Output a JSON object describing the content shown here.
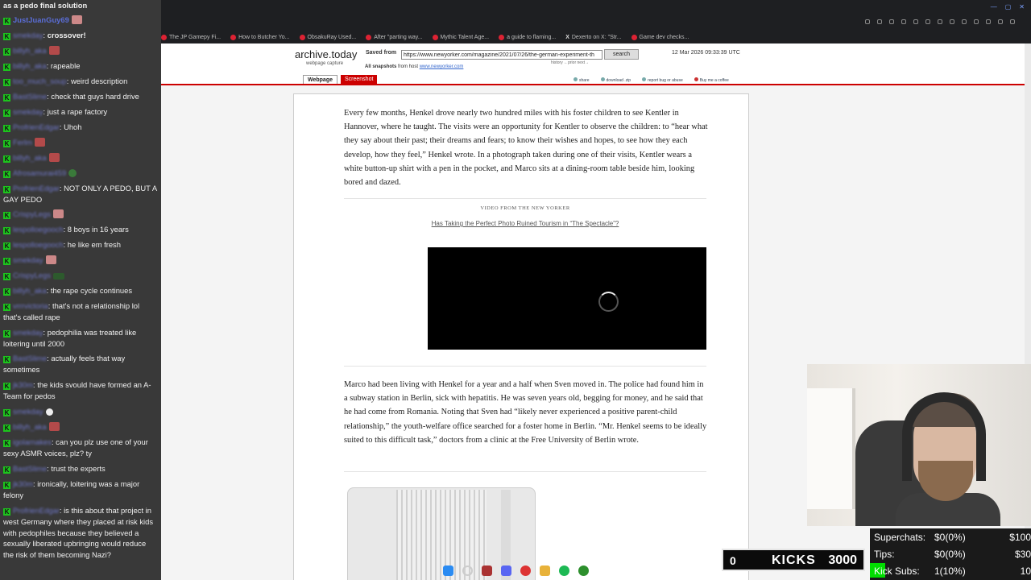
{
  "browser": {
    "bookmarks": [
      "The JP Gamepy Fi...",
      "How to Butcher Yo...",
      "ObsakuRay Used...",
      "After \"parting way...",
      "Mythic Talent Age...",
      "a guide to flaming...",
      "Dexerto on X: \"Str...",
      "Game dev checks..."
    ]
  },
  "archive": {
    "site_title": "archive.today",
    "site_sub": "webpage capture",
    "saved_from_label": "Saved from",
    "url": "https://www.newyorker.com/magazine/2021/07/26/the-german-experiment-th",
    "search_label": "search",
    "capture_date": "12 Mar 2026 09:33:39 UTC",
    "history_links": "history  ←prior  next→",
    "all_snapshots": "All snapshots",
    "from_host_label": "from host",
    "host": "www.newyorker.com",
    "tab_webpage": "Webpage",
    "tab_screenshot": "Screenshot",
    "util_share": "share",
    "util_download": "download .zip",
    "util_report": "report bug or abuse",
    "util_coffee": "Buy me a coffee"
  },
  "article": {
    "p1": "Every few months, Henkel drove nearly two hundred miles with his foster children to see Kentler in Hannover, where he taught. The visits were an opportunity for Kentler to observe the children: to “hear what they say about their past; their dreams and fears; to know their wishes and hopes, to see how they each develop, how they feel,” Henkel wrote. In a photograph taken during one of their visits, Kentler wears a white button-up shirt with a pen in the pocket, and Marco sits at a dining-room table beside him, looking bored and dazed.",
    "video_kicker": "VIDEO FROM THE NEW YORKER",
    "video_title": "Has Taking the Perfect Photo Ruined Tourism in “The Spectacle”?",
    "p2": "Marco had been living with Henkel for a year and a half when Sven moved in. The police had found him in a subway station in Berlin, sick with hepatitis. He was seven years old, begging for money, and he said that he had come from Romania. Noting that Sven had “likely never experienced a positive parent-child relationship,” the youth-welfare office searched for a foster home in Berlin. “Mr. Henkel seems to be ideally suited to this difficult task,” doctors from a clinic at the Free University of Berlin wrote."
  },
  "chat": {
    "messages": [
      {
        "user": "",
        "text": "as a pedo final solution"
      },
      {
        "user": "JustJuanGuy69",
        "text": ""
      },
      {
        "user": "smekday",
        "text": "crossover!"
      },
      {
        "user": "billyh_aka",
        "text": ""
      },
      {
        "user": "billyh_aka",
        "text": "rapeable"
      },
      {
        "user": "too_much_soup",
        "text": "weird description"
      },
      {
        "user": "BastSlime",
        "text": "check that guys hard drive"
      },
      {
        "user": "smekday",
        "text": "just a rape factory"
      },
      {
        "user": "ProfrienEdgar",
        "text": "Uhoh"
      },
      {
        "user": "Ferlm",
        "text": ""
      },
      {
        "user": "billyh_aka",
        "text": ""
      },
      {
        "user": "Afrosamurai459",
        "text": ""
      },
      {
        "user": "ProfrienEdgar",
        "text": "NOT ONLY A PEDO, BUT A GAY PEDO"
      },
      {
        "user": "CrispyLegs",
        "text": ""
      },
      {
        "user": "lespolloegooch",
        "text": "8 boys in 16 years"
      },
      {
        "user": "lespolloegooch",
        "text": "he like em fresh"
      },
      {
        "user": "smekday",
        "text": ""
      },
      {
        "user": "CrispyLegs",
        "text": ""
      },
      {
        "user": "billyh_aka",
        "text": "the rape cycle continues"
      },
      {
        "user": "vrrrvictoria",
        "text": "that's not a relationship lol that's called rape"
      },
      {
        "user": "smekday",
        "text": "pedophilia was treated like loitering until 2000"
      },
      {
        "user": "BastSlime",
        "text": "actually feels that way sometimes"
      },
      {
        "user": "jk30m",
        "text": "the kids svould have formed an A-Team for pedos"
      },
      {
        "user": "smekday",
        "text": ""
      },
      {
        "user": "billyh_aka",
        "text": ""
      },
      {
        "user": "igolarnakes",
        "text": "can you plz use one of your sexy ASMR voices, plz? ty"
      },
      {
        "user": "BastSlime",
        "text": "trust the experts"
      },
      {
        "user": "jk30m",
        "text": "ironically, loitering was a major felony"
      },
      {
        "user": "ProfrienEdgar",
        "text": "is this about that project in west Germany where they placed at risk kids with pedophiles because they believed a sexually liberated upbringing would reduce the risk of them becoming Nazi?"
      }
    ]
  },
  "stats": {
    "superchats_label": "Superchats:",
    "superchats_val": "$0(0%)",
    "superchats_goal": "$100",
    "tips_label": "Tips:",
    "tips_val": "$0(0%)",
    "tips_goal": "$30",
    "subs_label": "Kick Subs:",
    "subs_val": "1(10%)",
    "subs_goal": "10",
    "kicks_current": "0",
    "kicks_label": "KICKS",
    "kicks_goal": "3000"
  },
  "colors": {
    "kick_green": "#1dc41d",
    "archive_red": "#cc0000"
  }
}
